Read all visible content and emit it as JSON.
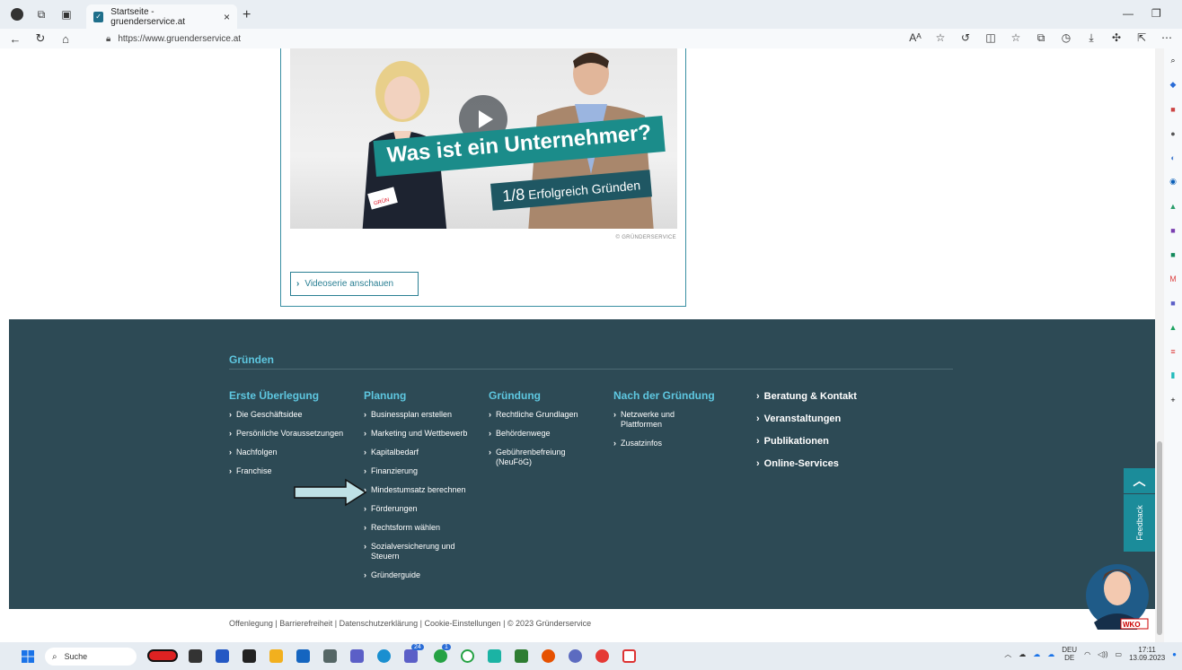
{
  "browser": {
    "tab_title": "Startseite - gruenderservice.at",
    "tab_close": "×",
    "new_tab": "+",
    "url": "https://www.gruenderservice.at",
    "read_aloud": "Aᴬ"
  },
  "video": {
    "banner_main": "Was ist ein Unternehmer?",
    "banner_sub_num": "1/8",
    "banner_sub_text": "Erfolgreich Gründen",
    "copyright": "© GRÜNDERSERVICE",
    "button_label": "Videoserie anschauen"
  },
  "footer": {
    "heading": "Gründen",
    "columns": [
      {
        "title": "Erste Überlegung",
        "items": [
          "Die Geschäftsidee",
          "Persönliche Voraussetzungen",
          "Nachfolgen",
          "Franchise"
        ]
      },
      {
        "title": "Planung",
        "items": [
          "Businessplan erstellen",
          "Marketing und Wettbewerb",
          "Kapitalbedarf",
          "Finanzierung",
          "Mindestumsatz berechnen",
          "Förderungen",
          "Rechtsform wählen",
          "Sozialversicherung und Steuern",
          "Gründerguide"
        ]
      },
      {
        "title": "Gründung",
        "items": [
          "Rechtliche Grundlagen",
          "Behördenwege",
          "Gebührenbefreiung (NeuFöG)"
        ]
      },
      {
        "title": "Nach der Gründung",
        "items": [
          "Netzwerke und Plattformen",
          "Zusatzinfos"
        ]
      }
    ],
    "right_links": [
      "Beratung & Kontakt",
      "Veranstaltungen",
      "Publikationen",
      "Online-Services"
    ]
  },
  "legal": {
    "links": [
      "Offenlegung",
      "Barrierefreiheit",
      "Datenschutzerklärung",
      "Cookie-Einstellungen",
      "© 2023 Gründerservice"
    ]
  },
  "floating": {
    "feedback": "Feedback",
    "avatar_badge": "WKO"
  },
  "taskbar": {
    "search_placeholder": "Suche",
    "lang_top": "DEU",
    "lang_bottom": "DE",
    "time": "17:11",
    "date": "13.09.2023",
    "badge_1": "24",
    "badge_2": "1"
  },
  "colors": {
    "footer_bg": "#2d4a55",
    "accent": "#5ec7e0",
    "teal_button": "#1b8c9a"
  }
}
